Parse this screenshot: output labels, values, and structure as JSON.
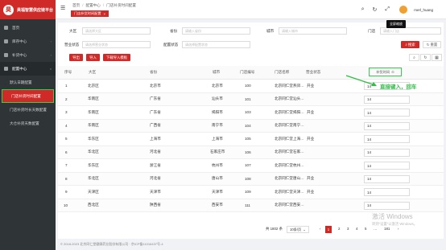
{
  "app": {
    "title": "昊福智慧供应链平台",
    "logo_char": "昊"
  },
  "sidebar": {
    "items": [
      {
        "label": "首页"
      },
      {
        "label": "库存中心"
      },
      {
        "label": "补货中心"
      },
      {
        "label": "配置中心"
      }
    ],
    "sub_items": [
      {
        "label": "默认日期配置"
      },
      {
        "label": "门店补货时间配置"
      },
      {
        "label": "门店补货时长天数配置"
      },
      {
        "label": "大仓补货天数配置"
      }
    ]
  },
  "topbar": {
    "breadcrumb": [
      "首页",
      "配置中心",
      "门店补货时间配置"
    ],
    "tab_label": "门店补货时间配置",
    "tab_close": "×",
    "username": "merl_huang",
    "tooltip": "全屏缩放"
  },
  "filters": {
    "area_label": "大区",
    "area_placeholder": "请选择大区",
    "province_label": "省份",
    "province_placeholder": "请输入省份",
    "city_label": "城市",
    "city_placeholder": "请输入城市",
    "store_label": "门店",
    "store_placeholder": "请输入门店",
    "biz_label": "营业状态",
    "biz_placeholder": "请选择营业状态",
    "cfg_label": "配置状态",
    "cfg_placeholder": "请选择配置状态"
  },
  "buttons": {
    "search": "搜索",
    "reset": "重置",
    "export": "导出",
    "import": "导入",
    "download": "下载导入模板"
  },
  "table": {
    "columns": [
      "序号",
      "大区",
      "省份",
      "城市",
      "门店编号",
      "门店名称",
      "营业状态",
      "补货时间"
    ],
    "rows": [
      {
        "no": "1",
        "area": "北京区",
        "province": "北京市",
        "city": "北京市",
        "code": "100",
        "name": "北京同仁堂燕郊…",
        "status": "开业",
        "time": "14"
      },
      {
        "no": "2",
        "area": "华南区",
        "province": "广东省",
        "city": "汕头市",
        "code": "101",
        "name": "北京同仁堂汕头…",
        "status": "",
        "time": "14"
      },
      {
        "no": "3",
        "area": "华南区",
        "province": "广东省",
        "city": "揭阳市",
        "code": "103",
        "name": "北京同仁堂揭阳…",
        "status": "开业",
        "time": "14"
      },
      {
        "no": "4",
        "area": "华南区",
        "province": "广西省",
        "city": "南宁市",
        "code": "104",
        "name": "北京同仁堂南宁…",
        "status": "",
        "time": "14"
      },
      {
        "no": "5",
        "area": "华东区",
        "province": "上海市",
        "city": "上海市",
        "code": "105",
        "name": "北京同仁堂上海…",
        "status": "开业",
        "time": "14"
      },
      {
        "no": "6",
        "area": "华北区",
        "province": "河北省",
        "city": "石家庄市",
        "code": "106",
        "name": "北京同仁堂石家…",
        "status": "",
        "time": "14"
      },
      {
        "no": "7",
        "area": "华东区",
        "province": "浙江省",
        "city": "杭州市",
        "code": "107",
        "name": "北京同仁堂杭州…",
        "status": "",
        "time": "14"
      },
      {
        "no": "8",
        "area": "华北区",
        "province": "河北省",
        "city": "唐山市",
        "code": "108",
        "name": "北京同仁堂唐山…",
        "status": "开业",
        "time": "14"
      },
      {
        "no": "9",
        "area": "天津区",
        "province": "天津市",
        "city": "天津市",
        "code": "109",
        "name": "北京同仁堂天津…",
        "status": "开业",
        "time": "14"
      },
      {
        "no": "10",
        "area": "西北区",
        "province": "陕西省",
        "city": "西安市",
        "code": "111",
        "name": "北京同仁堂西安…",
        "status": "",
        "time": "14"
      }
    ]
  },
  "annotation": {
    "text": "直接键入，回车"
  },
  "pagination": {
    "total": "共 1802 条",
    "page_size": "10条/页",
    "prev": "‹",
    "next": "›",
    "pages": [
      "1",
      "2",
      "3",
      "4",
      "5",
      "…",
      "181"
    ],
    "current": "1"
  },
  "footer": "© 2018-2023 北京同仁堂健康药业股份有限公司 · 京ICP备11016437号-4",
  "watermark": {
    "line1": "激活 Windows",
    "line2": "转到\"设置\"以激活 Windows。"
  },
  "colors": {
    "brand": "#cf2a27",
    "highlight": "#2fd14a",
    "sidebar": "#2f3437"
  }
}
